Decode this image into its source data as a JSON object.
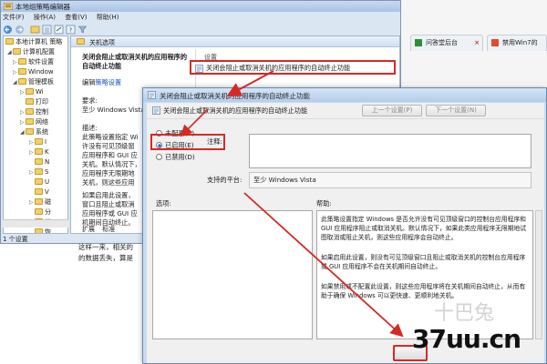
{
  "browser": {
    "tab1_label": "问答堂后台",
    "tab2_label": "禁用Win7的"
  },
  "editor": {
    "title": "本地组策略编辑器",
    "menu": [
      "文件(F)",
      "操作(A)",
      "查看(V)",
      "帮助(H)"
    ],
    "tree": [
      "本地计算机 策略",
      "计算机配置",
      "软件设置",
      "Window",
      "管理模板",
      "Wi",
      "打印",
      "控制",
      "网络",
      "系统",
      "I",
      "K",
      "N",
      "S",
      "U",
      "V",
      "磁",
      "分",
      "关",
      "恢"
    ],
    "pane_header": "关机选项",
    "pane_policy_title_1": "关闭会阻止或取消关机的应用程序的",
    "pane_policy_title_2": "自动终止功能",
    "edit_prefix": "编辑",
    "edit_link": "策略设置",
    "requirement_label": "要求:",
    "requirement_value": "至少 Windows Vista",
    "description_label": "描述:",
    "description_lines": [
      "此策略设置指定 Wi",
      "许没有可见顶级窗",
      "应用程序和 GUI 应",
      "关机。默认情况下，",
      "应用程序无限期地",
      "关机，则这些应用"
    ],
    "description_lines_2": [
      "如果启用此设置，",
      "窗口且阻止或取消",
      "应用程序或 GUI 应",
      "机期间自动终止。"
    ],
    "column_setting": "设置",
    "list_item": "关闭会阻止或取消关机的应用程序的自动终止功能",
    "tabs": [
      "扩展",
      "标准"
    ],
    "status": "1 个设置",
    "bottom_text_1": "这样一来，相关的",
    "bottom_text_2": "的数据丢失，算是"
  },
  "dialog": {
    "title": "关闭会阻止或取消关机的应用程序的自动终止功能",
    "subtitle": "关闭会阻止或取消关机的应用程序的自动终止功能",
    "prev_button": "上一个设置(P)",
    "next_button": "下一个设置(N)",
    "radio_options": [
      "未配置(C)",
      "已启用(E)",
      "已禁用(D)"
    ],
    "selected_radio": "已启用(E)",
    "comment_label": "注释:",
    "platform_label": "支持的平台:",
    "platform_value": "至少 Windows Vista",
    "options_label": "选项:",
    "help_label": "帮助:",
    "help_paragraphs": [
      "此策略设置指定 Windows 是否允许没有可见顶级窗口的控制台应用程序和 GUI 应用程序阻止或取消关机。默认情况下，如果此类应用程序无限期地试图取消或阻止关机，则这些应用程序会自动终止。",
      "如果启用此设置，则没有可见顶级窗口且阻止或取消关机的控制台应用程序或 GUI 应用程序不会在关机期间自动终止。",
      "如果禁用或不配置此设置，则这些应用程序将在关机期间自动终止，从而有助于确保 Windows 可以更快速、更顺利地关机。"
    ]
  },
  "watermark": {
    "text": "37uu.cn",
    "ghost": "十巴兔"
  },
  "colors": {
    "highlight_red": "#d42a26",
    "title_blue": "#b5cdeb"
  }
}
